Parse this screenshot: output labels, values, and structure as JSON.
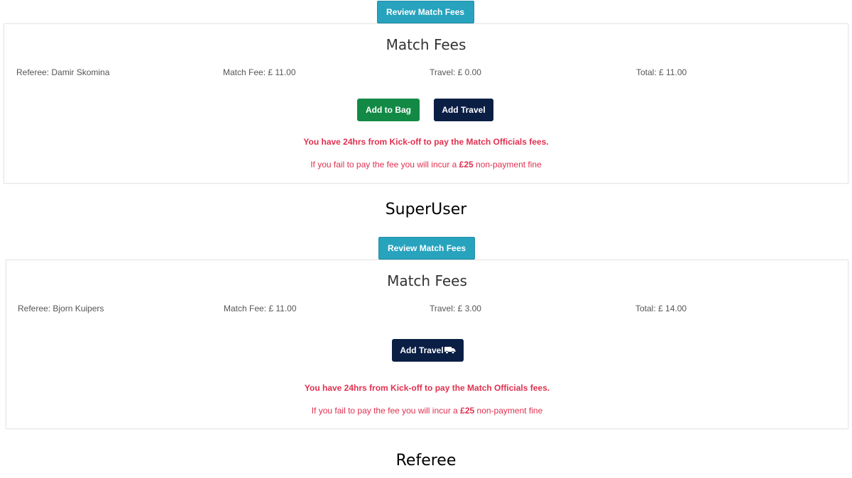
{
  "panels": [
    {
      "review_label": "Review Match Fees",
      "title": "Match Fees",
      "referee": "Referee: Damir Skomina",
      "match_fee": "Match Fee: £ 11.00",
      "travel": "Travel: £ 0.00",
      "total": "Total: £ 11.00",
      "add_to_bag_label": "Add to Bag",
      "add_travel_label": "Add Travel",
      "warning": "You have 24hrs from Kick-off to pay the Match Officials fees.",
      "fine_prefix": "If you fail to pay the fee you will incur a ",
      "fine_amount": "£25",
      "fine_suffix": " non-payment fine",
      "caption": "SuperUser"
    },
    {
      "review_label": "Review Match Fees",
      "title": "Match Fees",
      "referee": "Referee: Bjorn Kuipers",
      "match_fee": "Match Fee: £ 11.00",
      "travel": "Travel: £ 3.00",
      "total": "Total: £ 14.00",
      "add_travel_label": "Add Travel",
      "add_travel_icon": "van-icon",
      "warning": "You have 24hrs from Kick-off to pay the Match Officials fees.",
      "fine_prefix": "If you fail to pay the fee you will incur a ",
      "fine_amount": "£25",
      "fine_suffix": " non-payment fine",
      "caption": "Referee"
    }
  ],
  "colors": {
    "review_button": "#27a3be",
    "add_to_bag": "#128a45",
    "add_travel": "#0b1f45",
    "warning_text": "#e0304f"
  }
}
